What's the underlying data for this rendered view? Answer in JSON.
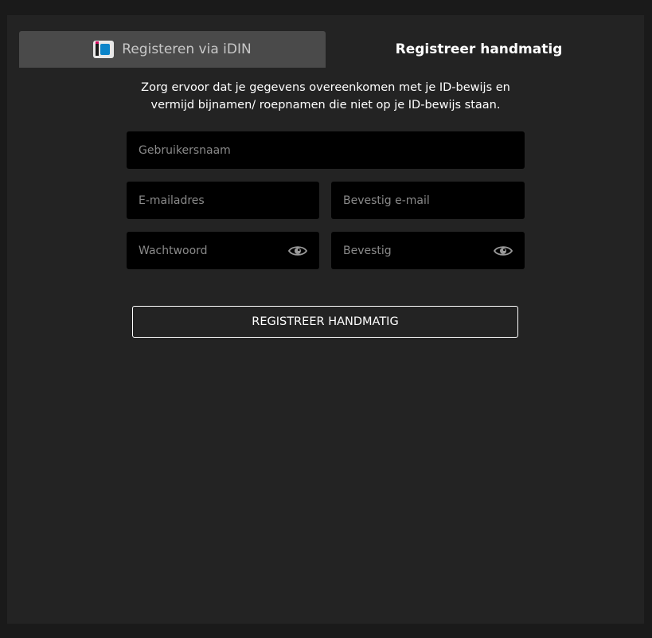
{
  "tabs": {
    "idin_label": "Registeren via iDIN",
    "manual_label": "Registreer handmatig"
  },
  "intro": {
    "line1": "Zorg ervoor dat je gegevens overeenkomen met je ID-bewijs en",
    "line2": "vermijd bijnamen/ roepnamen die niet op je ID-bewijs staan."
  },
  "form": {
    "username_placeholder": "Gebruikersnaam",
    "email_placeholder": "E-mailadres",
    "confirm_email_placeholder": "Bevestig e-mail",
    "password_placeholder": "Wachtwoord",
    "confirm_password_placeholder": "Bevestig",
    "submit_label": "REGISTREER HANDMATIG"
  },
  "icons": {
    "idin_logo": "idin-logo-icon",
    "password_toggle": "eye-icon"
  },
  "colors": {
    "background": "#1a1a1a",
    "panel": "#232323",
    "active_tab": "#4a4a4a",
    "input_background": "#000000",
    "text": "#ffffff",
    "placeholder": "#8a8a8a"
  }
}
